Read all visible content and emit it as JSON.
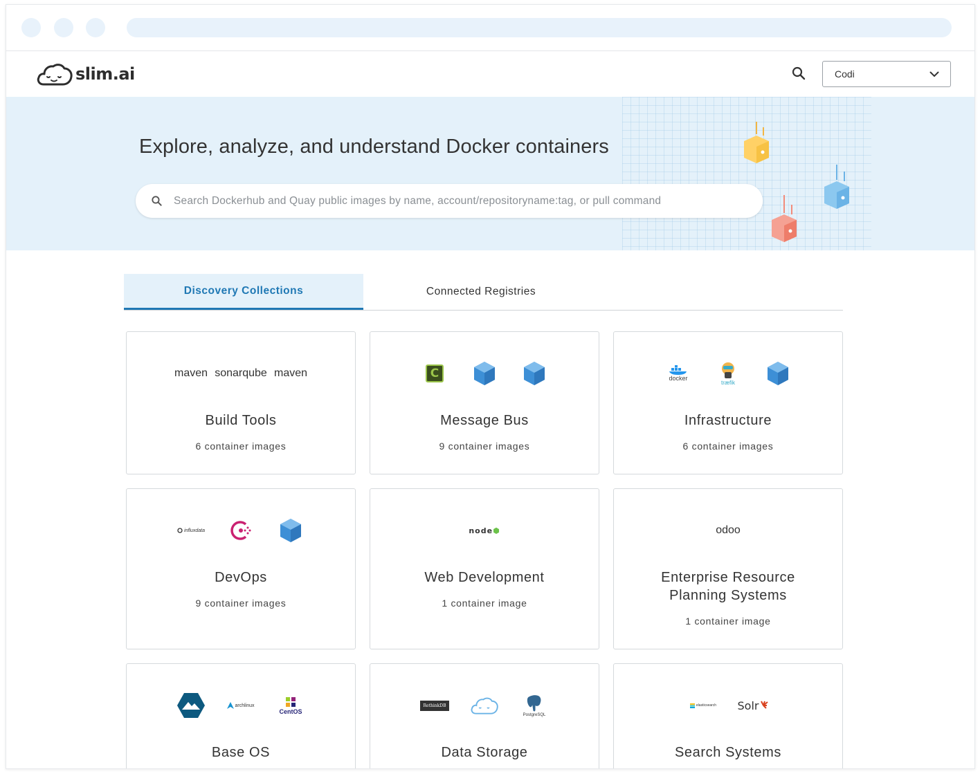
{
  "brand": {
    "name": "slim.ai"
  },
  "header": {
    "user": "Codi"
  },
  "hero": {
    "title": "Explore, analyze, and understand Docker containers",
    "search_placeholder": "Search Dockerhub and Quay public images by name, account/repositoryname:tag, or pull command"
  },
  "tabs": [
    {
      "label": "Discovery Collections",
      "active": true
    },
    {
      "label": "Connected Registries",
      "active": false
    }
  ],
  "collections": [
    {
      "title": "Build Tools",
      "count": "6 container images",
      "logos": [
        "maven",
        "sonarqube",
        "maven"
      ]
    },
    {
      "title": "Message Bus",
      "count": "9 container images",
      "logos": [
        "celery",
        "generic-cube",
        "generic-cube"
      ]
    },
    {
      "title": "Infrastructure",
      "count": "6 container images",
      "logos": [
        "docker",
        "traefik",
        "generic-cube"
      ]
    },
    {
      "title": "DevOps",
      "count": "9 container images",
      "logos": [
        "influxdata",
        "consul",
        "generic-cube"
      ]
    },
    {
      "title": "Web Development",
      "count": "1 container image",
      "logos": [
        "nodejs"
      ]
    },
    {
      "title": "Enterprise Resource Planning Systems",
      "title_lines": [
        "Enterprise Resource",
        "Planning Systems"
      ],
      "count": "1 container image",
      "logos": [
        "odoo"
      ]
    },
    {
      "title": "Base OS",
      "count": "",
      "logos": [
        "alpine",
        "archlinux",
        "centos"
      ]
    },
    {
      "title": "Data Storage",
      "count": "",
      "logos": [
        "rethinkdb",
        "slim-cloud",
        "postgresql"
      ]
    },
    {
      "title": "Search Systems",
      "count": "",
      "logos": [
        "elasticsearch",
        "solr"
      ]
    }
  ],
  "logo_text": {
    "maven": "maven",
    "sonarqube": "sonarqube",
    "docker": "docker",
    "traefik": "træfik",
    "influxdata": "influxdata",
    "nodejs": "node",
    "odoo": "odoo",
    "archlinux": "archlinux",
    "centos": "CentOS",
    "rethinkdb": "RethinkDB",
    "postgresql": "PostgreSQL",
    "elasticsearch": "elasticsearch",
    "solr": "Solr",
    "celery": "C"
  },
  "colors": {
    "accent": "#1f78b4",
    "hero_bg": "#e4f1fa",
    "cube": "#3d8fd6"
  }
}
